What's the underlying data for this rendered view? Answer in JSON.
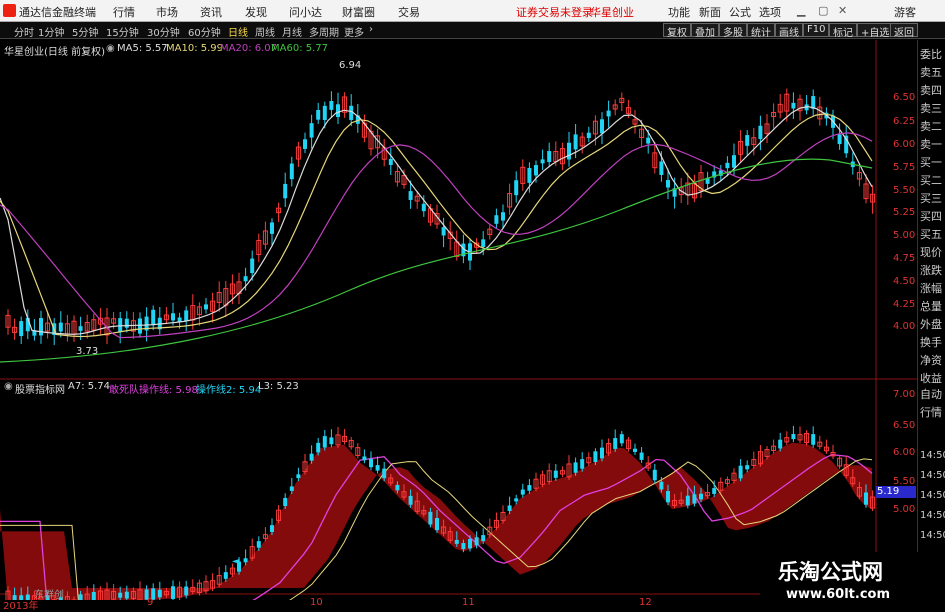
{
  "app": {
    "title": "通达信金融终端"
  },
  "menu": {
    "items": [
      "行情",
      "市场",
      "资讯",
      "发现",
      "问小达",
      "财富圈",
      "交易"
    ],
    "notice": "证券交易未登录",
    "broker": "华星创业",
    "right": [
      "功能",
      "新面",
      "公式",
      "选项"
    ],
    "guest": "游客"
  },
  "periods": [
    "分时",
    "1分钟",
    "5分钟",
    "15分钟",
    "30分钟",
    "60分钟",
    "日线",
    "周线",
    "月线",
    "多周期",
    "更多"
  ],
  "active_period": "日线",
  "tools": [
    "复权",
    "叠加",
    "多股",
    "统计",
    "画线",
    "F10",
    "标记",
    "+自选",
    "返回"
  ],
  "main_legend": {
    "title": "华星创业(日线 前复权)",
    "ma5": "MA5: 5.57",
    "ma10": "MA10: 5.99",
    "ma20": "MA20: 6.07",
    "ma60": "MA60: 5.77"
  },
  "sub_legend": {
    "title": "股票指标网",
    "a7": "A7: 5.74",
    "l1": "敢死队操作线: 5.98",
    "l2": "操作线2: 5.94",
    "l3": "L3: 5.23"
  },
  "price_axis": [
    "6.50",
    "6.25",
    "6.00",
    "5.75",
    "5.50",
    "5.25",
    "5.00",
    "4.75",
    "4.50",
    "4.25",
    "4.00"
  ],
  "sub_axis": [
    "7.00",
    "6.50",
    "6.00",
    "5.50",
    "5.00"
  ],
  "sub_axis_time": [
    "14:50",
    "14:50",
    "14:50",
    "14:50",
    "14:50"
  ],
  "current_value": "5.19",
  "date_labels": [
    "2013年",
    "9",
    "10",
    "11",
    "12"
  ],
  "annotations": {
    "high": "6.94",
    "low": "3.73",
    "sub_low": "东群创"
  },
  "right_panel": [
    "委比",
    "卖五",
    "卖四",
    "卖三",
    "卖二",
    "卖一",
    "买一",
    "买二",
    "买三",
    "买四",
    "买五",
    "现价",
    "涨跌",
    "涨幅",
    "总量",
    "外盘",
    "换手",
    "净资",
    "收益"
  ],
  "sub_right_panel": [
    "自动",
    "行情"
  ],
  "watermark": {
    "line1": "乐淘公式网",
    "line2": "www.60lt.com"
  },
  "colors": {
    "up": "#ff3b3b",
    "down": "#22d4f4",
    "ma5": "#dddddd",
    "ma10": "#e6d77a",
    "ma20": "#c040c0",
    "ma60": "#3ec43e",
    "cloud": "#8a0c0c"
  }
}
